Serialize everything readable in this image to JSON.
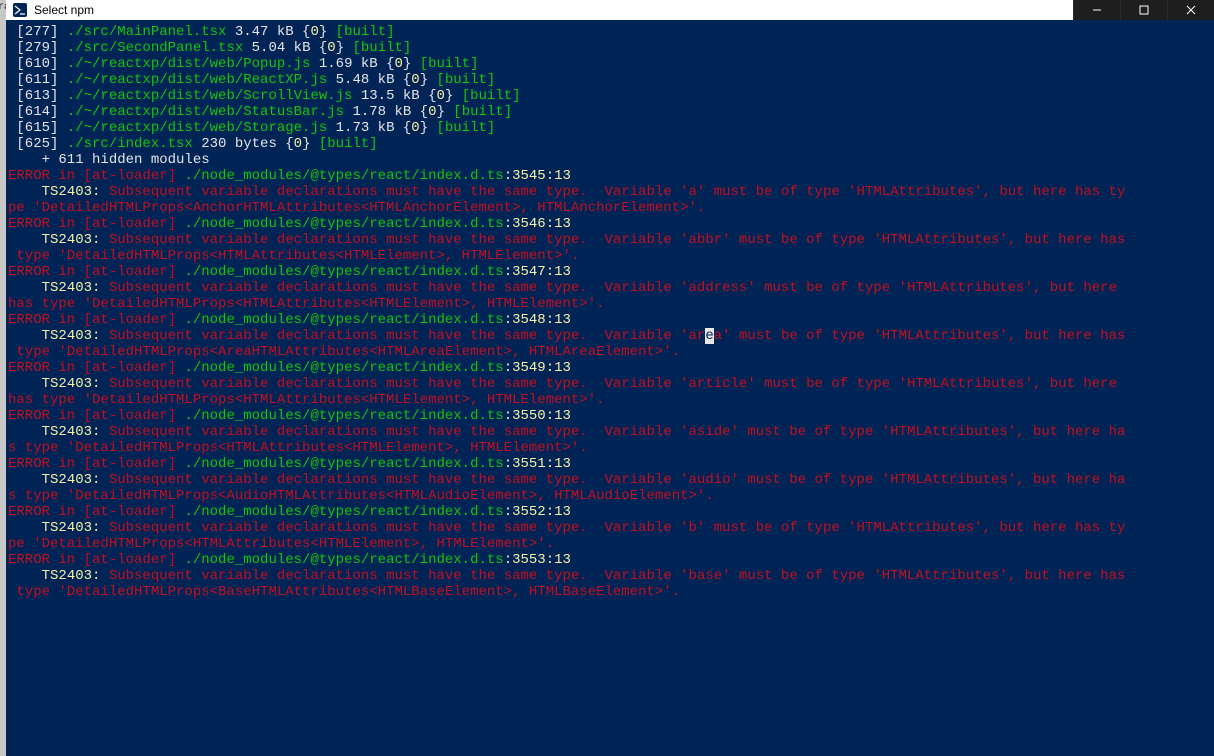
{
  "window_title": "Select npm",
  "build_lines": [
    {
      "id": "277",
      "path": "./src/MainPanel.tsx",
      "size": "3.47 kB",
      "chunk": "0",
      "status": "[built]"
    },
    {
      "id": "279",
      "path": "./src/SecondPanel.tsx",
      "size": "5.04 kB",
      "chunk": "0",
      "status": "[built]"
    },
    {
      "id": "610",
      "path": "./~/reactxp/dist/web/Popup.js",
      "size": "1.69 kB",
      "chunk": "0",
      "status": "[built]"
    },
    {
      "id": "611",
      "path": "./~/reactxp/dist/web/ReactXP.js",
      "size": "5.48 kB",
      "chunk": "0",
      "status": "[built]"
    },
    {
      "id": "613",
      "path": "./~/reactxp/dist/web/ScrollView.js",
      "size": "13.5 kB",
      "chunk": "0",
      "status": "[built]"
    },
    {
      "id": "614",
      "path": "./~/reactxp/dist/web/StatusBar.js",
      "size": "1.78 kB",
      "chunk": "0",
      "status": "[built]"
    },
    {
      "id": "615",
      "path": "./~/reactxp/dist/web/Storage.js",
      "size": "1.73 kB",
      "chunk": "0",
      "status": "[built]"
    },
    {
      "id": "625",
      "path": "./src/index.tsx",
      "size": "230 bytes",
      "chunk": "0",
      "status": "[built]"
    }
  ],
  "hidden_modules_line": "    + 611 hidden modules",
  "errors": [
    {
      "loc": "3545:13",
      "msg": "Subsequent variable declarations must have the same type.  Variable 'a' must be of type 'HTMLAttributes', but here has type 'DetailedHTMLProps<AnchorHTMLAttributes<HTMLAnchorElement>, HTMLAnchorElement>'."
    },
    {
      "loc": "3546:13",
      "msg": "Subsequent variable declarations must have the same type.  Variable 'abbr' must be of type 'HTMLAttributes', but here has type 'DetailedHTMLProps<HTMLAttributes<HTMLElement>, HTMLElement>'."
    },
    {
      "loc": "3547:13",
      "msg": "Subsequent variable declarations must have the same type.  Variable 'address' must be of type 'HTMLAttributes', but here has type 'DetailedHTMLProps<HTMLAttributes<HTMLElement>, HTMLElement>'."
    },
    {
      "loc": "3548:13",
      "msg_before_cursor": "Subsequent variable declarations must have the same type.  Variable 'ar",
      "cursor_char": "e",
      "msg_after_cursor": "a' must be of type 'HTMLAttributes', but here has type 'DetailedHTMLProps<AreaHTMLAttributes<HTMLAreaElement>, HTMLAreaElement>'."
    },
    {
      "loc": "3549:13",
      "msg": "Subsequent variable declarations must have the same type.  Variable 'article' must be of type 'HTMLAttributes', but here has type 'DetailedHTMLProps<HTMLAttributes<HTMLElement>, HTMLElement>'."
    },
    {
      "loc": "3550:13",
      "msg": "Subsequent variable declarations must have the same type.  Variable 'aside' must be of type 'HTMLAttributes', but here has type 'DetailedHTMLProps<HTMLAttributes<HTMLElement>, HTMLElement>'."
    },
    {
      "loc": "3551:13",
      "msg": "Subsequent variable declarations must have the same type.  Variable 'audio' must be of type 'HTMLAttributes', but here has type 'DetailedHTMLProps<AudioHTMLAttributes<HTMLAudioElement>, HTMLAudioElement>'."
    },
    {
      "loc": "3552:13",
      "msg": "Subsequent variable declarations must have the same type.  Variable 'b' must be of type 'HTMLAttributes', but here has type 'DetailedHTMLProps<HTMLAttributes<HTMLElement>, HTMLElement>'."
    },
    {
      "loc": "3553:13",
      "msg": "Subsequent variable declarations must have the same type.  Variable 'base' must be of type 'HTMLAttributes', but here has type 'DetailedHTMLProps<BaseHTMLAttributes<HTMLBaseElement>, HTMLBaseElement>'."
    }
  ],
  "error_prefix_red": "ERROR in [at-loader] ",
  "error_path_green": "./node_modules/@types/react/index.d.ts",
  "error_code": "TS2403:",
  "error_code_indent": "    ",
  "left_edge_frag1": "ra",
  "left_edge_frag2": "c"
}
